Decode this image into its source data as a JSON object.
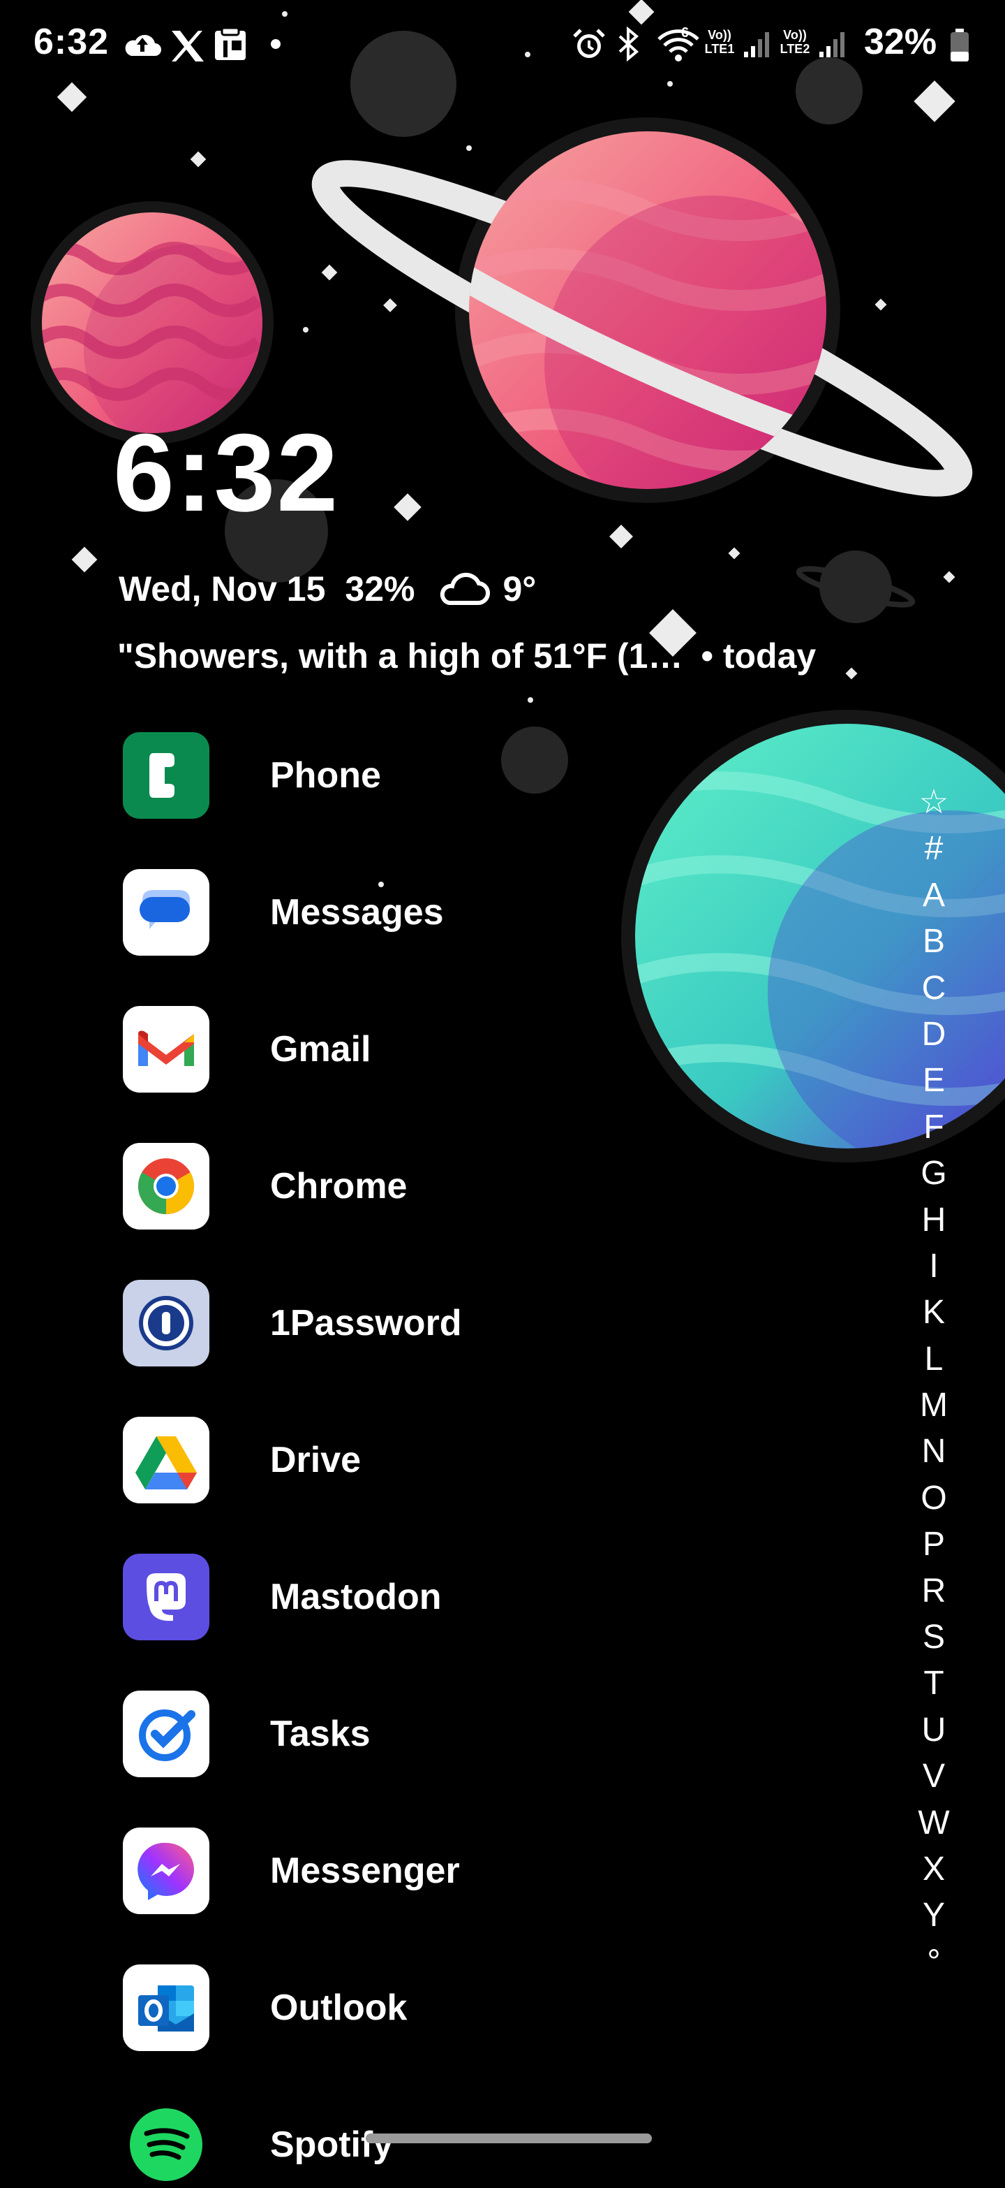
{
  "status_bar": {
    "time": "6:32",
    "battery_percent": "32%",
    "sim1_label": "Vo)) LTE1",
    "sim2_label": "Vo)) LTE2",
    "wifi_label": "6",
    "icons": [
      "cloud-upload-icon",
      "x-icon",
      "clipboard-icon",
      "dot-icon",
      "alarm-icon",
      "bluetooth-icon",
      "wifi-icon",
      "signal-icon",
      "signal-icon",
      "battery-icon"
    ]
  },
  "widget": {
    "clock": "6:32",
    "date": "Wed, Nov 15",
    "battery": "32%",
    "weather_temp": "9°",
    "weather_icon": "cloud-icon",
    "forecast": "\"Showers, with a high of 51°F (1…",
    "forecast_suffix": "• today"
  },
  "apps": [
    {
      "label": "Phone",
      "icon": "phone-icon"
    },
    {
      "label": "Messages",
      "icon": "messages-icon"
    },
    {
      "label": "Gmail",
      "icon": "gmail-icon"
    },
    {
      "label": "Chrome",
      "icon": "chrome-icon"
    },
    {
      "label": "1Password",
      "icon": "onepassword-icon"
    },
    {
      "label": "Drive",
      "icon": "drive-icon"
    },
    {
      "label": "Mastodon",
      "icon": "mastodon-icon"
    },
    {
      "label": "Tasks",
      "icon": "tasks-icon"
    },
    {
      "label": "Messenger",
      "icon": "messenger-icon"
    },
    {
      "label": "Outlook",
      "icon": "outlook-icon"
    },
    {
      "label": "Spotify",
      "icon": "spotify-icon"
    }
  ],
  "alphabet_index": [
    "☆",
    "#",
    "A",
    "B",
    "C",
    "D",
    "E",
    "F",
    "G",
    "H",
    "I",
    "K",
    "L",
    "M",
    "N",
    "O",
    "P",
    "R",
    "S",
    "T",
    "U",
    "V",
    "W",
    "X",
    "Y",
    "°"
  ],
  "colors": {
    "background": "#000000",
    "text": "#ffffff",
    "phone_green": "#0b8a4f",
    "mastodon_purple": "#5d4ee2",
    "spotify_green": "#1ed760"
  }
}
